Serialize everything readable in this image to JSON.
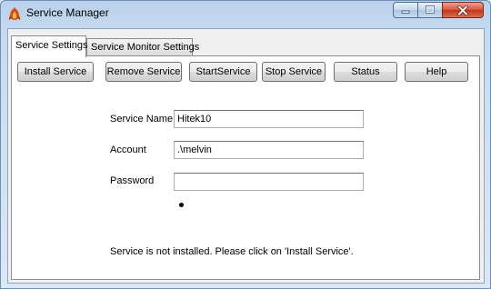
{
  "window": {
    "title": "Service Manager",
    "icon": "app-flame-icon",
    "controls": {
      "minimize": "minimize-icon",
      "maximize": "maximize-icon",
      "close": "close-icon"
    }
  },
  "tabs": [
    {
      "label": "Service Settings",
      "active": true
    },
    {
      "label": "Service Monitor Settings",
      "active": false
    }
  ],
  "toolbar": {
    "install": "Install Service",
    "remove": "Remove Service",
    "start": "StartService",
    "stop": "Stop Service",
    "status": "Status",
    "help": "Help"
  },
  "form": {
    "service_name": {
      "label": "Service Name",
      "value": "Hitek10"
    },
    "account": {
      "label": "Account",
      "value": ".\\melvin"
    },
    "password": {
      "label": "Password",
      "value": ""
    }
  },
  "status_message": "Service is not installed.  Please click on 'Install Service'.",
  "colors": {
    "titlebar": "#b9d1ea",
    "close_button": "#c23416",
    "panel": "#ffffff"
  }
}
